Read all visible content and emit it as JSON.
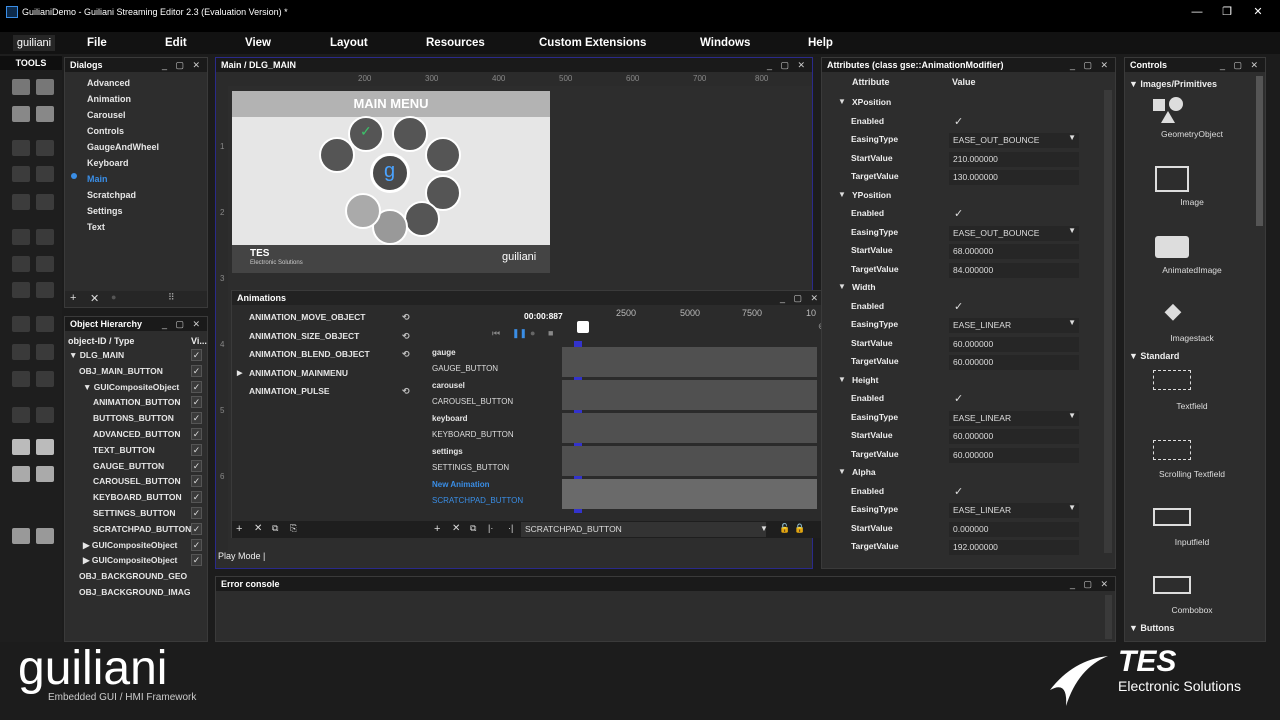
{
  "window": {
    "title": "GuilianiDemo - Guiliani Streaming Editor 2.3 (Evaluation Version) *",
    "minimize": "—",
    "restore": "❐",
    "close": "✕"
  },
  "menu": {
    "logo": "guiliani",
    "items": [
      "File",
      "Edit",
      "View",
      "Layout",
      "Resources",
      "Custom Extensions",
      "Windows",
      "Help"
    ]
  },
  "tools": {
    "label": "TOOLS"
  },
  "dialogs": {
    "title": "Dialogs",
    "items": [
      "Advanced",
      "Animation",
      "Carousel",
      "Controls",
      "GaugeAndWheel",
      "Keyboard",
      "Main",
      "Scratchpad",
      "Settings",
      "Text"
    ],
    "selected": "Main"
  },
  "hierarchy": {
    "title": "Object Hierarchy",
    "col1": "object-ID / Type",
    "col2": "Vi...",
    "rows": [
      {
        "label": "DLG_MAIN",
        "prefix": "▼"
      },
      {
        "label": "OBJ_MAIN_BUTTON",
        "prefix": ""
      },
      {
        "label": "GUICompositeObject",
        "prefix": "▼"
      },
      {
        "label": "ANIMATION_BUTTON",
        "prefix": ""
      },
      {
        "label": "BUTTONS_BUTTON",
        "prefix": ""
      },
      {
        "label": "ADVANCED_BUTTON",
        "prefix": ""
      },
      {
        "label": "TEXT_BUTTON",
        "prefix": ""
      },
      {
        "label": "GAUGE_BUTTON",
        "prefix": ""
      },
      {
        "label": "CAROUSEL_BUTTON",
        "prefix": ""
      },
      {
        "label": "KEYBOARD_BUTTON",
        "prefix": ""
      },
      {
        "label": "SETTINGS_BUTTON",
        "prefix": ""
      },
      {
        "label": "SCRATCHPAD_BUTTON",
        "prefix": ""
      },
      {
        "label": "GUICompositeObject",
        "prefix": "▶"
      },
      {
        "label": "GUICompositeObject",
        "prefix": "▶"
      },
      {
        "label": "OBJ_BACKGROUND_GEO",
        "prefix": ""
      },
      {
        "label": "OBJ_BACKGROUND_IMAGE",
        "prefix": ""
      }
    ]
  },
  "main": {
    "title": "Main / DLG_MAIN",
    "ruler_x": [
      "200",
      "300",
      "400",
      "500",
      "600",
      "700",
      "800"
    ],
    "ruler_y": [
      "1",
      "2",
      "3",
      "4",
      "5",
      "6"
    ],
    "preview_title": "MAIN MENU",
    "preview_logo": "guiliani",
    "preview_tes": "TES",
    "preview_tes_sub": "Electronic Solutions",
    "status": "Play Mode |"
  },
  "animations": {
    "title": "Animations",
    "list": [
      {
        "label": "ANIMATION_MOVE_OBJECT",
        "expander": ""
      },
      {
        "label": "ANIMATION_SIZE_OBJECT",
        "expander": ""
      },
      {
        "label": "ANIMATION_BLEND_OBJECT",
        "expander": ""
      },
      {
        "label": "ANIMATION_MAINMENU",
        "expander": "▶"
      },
      {
        "label": "ANIMATION_PULSE",
        "expander": ""
      }
    ],
    "time": "00:00:887",
    "ticks": [
      "2500",
      "5000",
      "7500",
      "10"
    ],
    "tracks": [
      {
        "group": "gauge",
        "object": "GAUGE_BUTTON"
      },
      {
        "group": "carousel",
        "object": "CAROUSEL_BUTTON"
      },
      {
        "group": "keyboard",
        "object": "KEYBOARD_BUTTON"
      },
      {
        "group": "settings",
        "object": "SETTINGS_BUTTON"
      },
      {
        "group": "New Animation",
        "object": "SCRATCHPAD_BUTTON"
      }
    ],
    "selected_object": "SCRATCHPAD_BUTTON"
  },
  "attributes": {
    "title": "Attributes  (class gse::AnimationModifier)",
    "col1": "Attribute",
    "col2": "Value",
    "sections": [
      {
        "name": "XPosition",
        "rows": [
          {
            "k": "Enabled",
            "v": "✓",
            "type": "check"
          },
          {
            "k": "EasingType",
            "v": "EASE_OUT_BOUNCE",
            "type": "dd"
          },
          {
            "k": "StartValue",
            "v": "210.000000",
            "type": "text"
          },
          {
            "k": "TargetValue",
            "v": "130.000000",
            "type": "text"
          }
        ]
      },
      {
        "name": "YPosition",
        "rows": [
          {
            "k": "Enabled",
            "v": "✓",
            "type": "check"
          },
          {
            "k": "EasingType",
            "v": "EASE_OUT_BOUNCE",
            "type": "dd"
          },
          {
            "k": "StartValue",
            "v": "68.000000",
            "type": "text"
          },
          {
            "k": "TargetValue",
            "v": "84.000000",
            "type": "text"
          }
        ]
      },
      {
        "name": "Width",
        "rows": [
          {
            "k": "Enabled",
            "v": "✓",
            "type": "check"
          },
          {
            "k": "EasingType",
            "v": "EASE_LINEAR",
            "type": "dd"
          },
          {
            "k": "StartValue",
            "v": "60.000000",
            "type": "text"
          },
          {
            "k": "TargetValue",
            "v": "60.000000",
            "type": "text"
          }
        ]
      },
      {
        "name": "Height",
        "rows": [
          {
            "k": "Enabled",
            "v": "✓",
            "type": "check"
          },
          {
            "k": "EasingType",
            "v": "EASE_LINEAR",
            "type": "dd"
          },
          {
            "k": "StartValue",
            "v": "60.000000",
            "type": "text"
          },
          {
            "k": "TargetValue",
            "v": "60.000000",
            "type": "text"
          }
        ]
      },
      {
        "name": "Alpha",
        "rows": [
          {
            "k": "Enabled",
            "v": "✓",
            "type": "check"
          },
          {
            "k": "EasingType",
            "v": "EASE_LINEAR",
            "type": "dd"
          },
          {
            "k": "StartValue",
            "v": "0.000000",
            "type": "text"
          },
          {
            "k": "TargetValue",
            "v": "192.000000",
            "type": "text"
          }
        ]
      }
    ]
  },
  "controls": {
    "title": "Controls",
    "cat1": "Images/Primitives",
    "items1": [
      "GeometryObject",
      "Image",
      "AnimatedImage",
      "Imagestack"
    ],
    "cat2": "Standard",
    "items2": [
      "Textfield",
      "Scrolling Textfield",
      "Inputfield",
      "Combobox"
    ],
    "cat3": "Buttons"
  },
  "console": {
    "title": "Error console"
  },
  "footer": {
    "logo": "guiliani",
    "tagline": "Embedded GUI / HMI Framework",
    "tes": "TES",
    "tes_sub": "Electronic Solutions"
  }
}
